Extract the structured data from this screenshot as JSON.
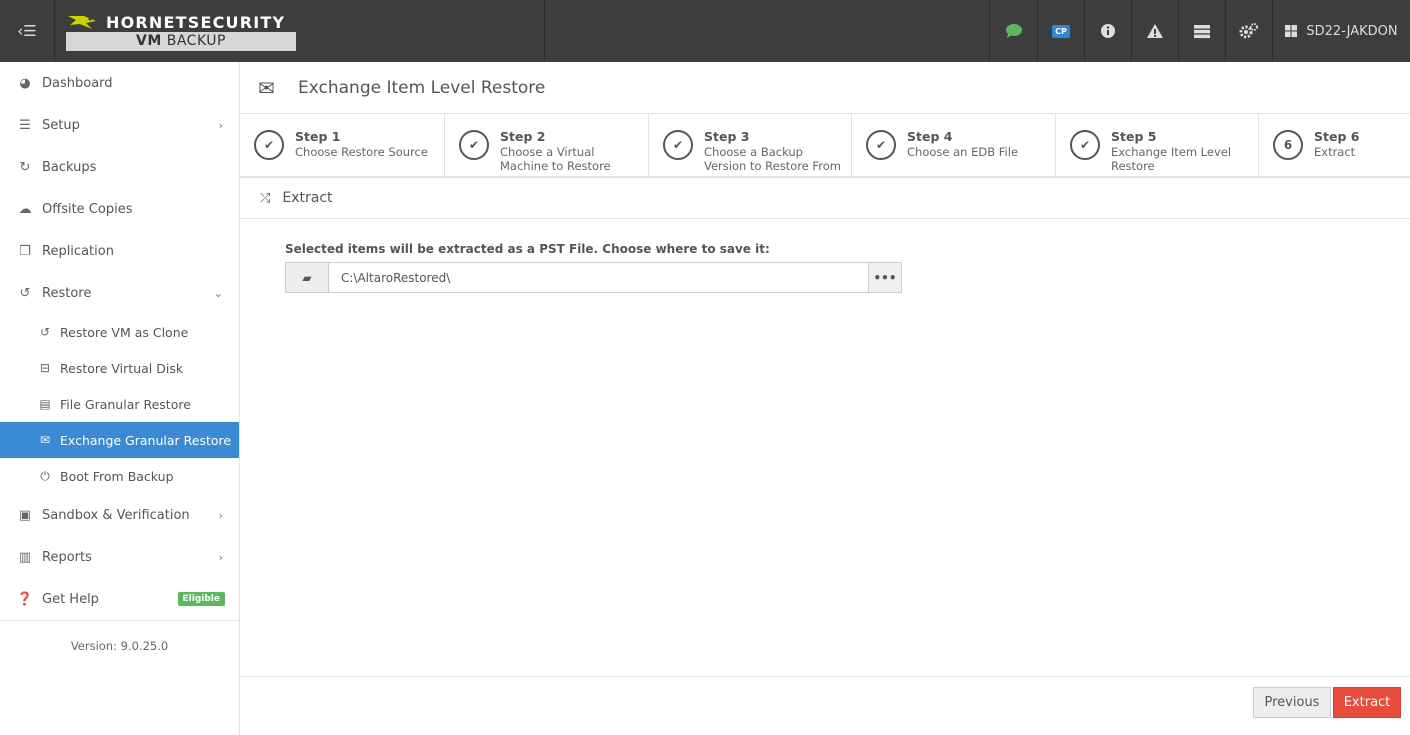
{
  "topbar": {
    "brand": "HORNETSECURITY",
    "product_prefix": "VM",
    "product_name": "BACKUP",
    "cp_label": "CP",
    "user": "SD22-JAKDON",
    "icons": [
      "chat-icon",
      "cp-icon",
      "info-icon",
      "warning-icon",
      "server-icon",
      "settings-icon"
    ],
    "chat_color": "#5cb85c"
  },
  "sidebar": {
    "items": [
      {
        "label": "Dashboard",
        "icon": "dashboard-icon"
      },
      {
        "label": "Setup",
        "icon": "sliders-icon"
      },
      {
        "label": "Backups",
        "icon": "refresh-icon"
      },
      {
        "label": "Offsite Copies",
        "icon": "cloud-upload-icon"
      },
      {
        "label": "Replication",
        "icon": "copy-icon"
      },
      {
        "label": "Restore",
        "icon": "undo-icon"
      }
    ],
    "restore_sub": [
      {
        "label": "Restore VM as Clone",
        "icon": "undo-icon"
      },
      {
        "label": "Restore Virtual Disk",
        "icon": "hdd-icon"
      },
      {
        "label": "File Granular Restore",
        "icon": "file-icon"
      },
      {
        "label": "Exchange Granular Restore",
        "icon": "envelope-icon"
      },
      {
        "label": "Boot From Backup",
        "icon": "power-icon"
      }
    ],
    "more": [
      {
        "label": "Sandbox & Verification",
        "icon": "archive-icon"
      },
      {
        "label": "Reports",
        "icon": "bar-chart-icon"
      },
      {
        "label": "Get Help",
        "icon": "question-icon"
      }
    ],
    "help_badge": "Eligible",
    "version": "Version: 9.0.25.0",
    "active_color": "#3a8ad4"
  },
  "page": {
    "title": "Exchange Item Level Restore",
    "steps": [
      {
        "num": "Step 1",
        "desc": "Choose Restore Source",
        "marker": "✔"
      },
      {
        "num": "Step 2",
        "desc": "Choose a Virtual Machine to Restore",
        "marker": "✔"
      },
      {
        "num": "Step 3",
        "desc": "Choose a Backup Version to Restore From",
        "marker": "✔"
      },
      {
        "num": "Step 4",
        "desc": "Choose an EDB File",
        "marker": "✔"
      },
      {
        "num": "Step 5",
        "desc": "Exchange Item Level Restore",
        "marker": "✔"
      },
      {
        "num": "Step 6",
        "desc": "Extract",
        "marker": "6"
      }
    ],
    "section": "Extract",
    "prompt": "Selected items will be extracted as a PST File. Choose where to save it:",
    "path_value": "C:\\AltaroRestored\\",
    "browse_label": "•••",
    "prev_label": "Previous",
    "extract_label": "Extract",
    "extract_color": "#e74c3c"
  }
}
